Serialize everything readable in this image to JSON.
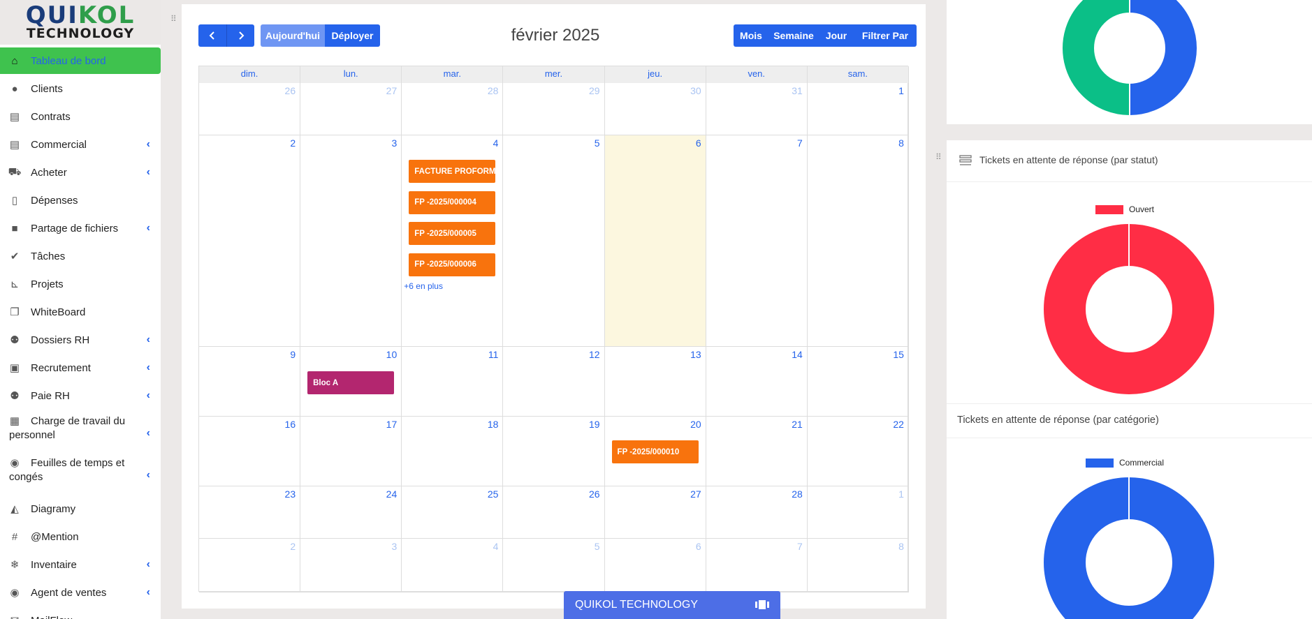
{
  "logo": {
    "line1_a": "QUI",
    "line1_b": "KOL",
    "line2": "TECHNOLOGY"
  },
  "sidebar": {
    "items": [
      {
        "label": "Tableau de bord",
        "icon": "home-icon",
        "active": true
      },
      {
        "label": "Clients",
        "icon": "user-icon"
      },
      {
        "label": "Contrats",
        "icon": "contract-icon"
      },
      {
        "label": "Commercial",
        "icon": "receipt-icon",
        "chevron": true
      },
      {
        "label": "Acheter",
        "icon": "cart-icon",
        "chevron": true
      },
      {
        "label": "Dépenses",
        "icon": "file-icon"
      },
      {
        "label": "Partage de fichiers",
        "icon": "folder-icon",
        "chevron": true
      },
      {
        "label": "Tâches",
        "icon": "check-circle-icon"
      },
      {
        "label": "Projets",
        "icon": "chart-icon"
      },
      {
        "label": "WhiteBoard",
        "icon": "copy-icon"
      },
      {
        "label": "Dossiers RH",
        "icon": "users-icon",
        "chevron": true
      },
      {
        "label": "Recrutement",
        "icon": "id-card-icon",
        "chevron": true
      },
      {
        "label": "Paie RH",
        "icon": "users-icon",
        "chevron": true
      },
      {
        "label": "Charge de travail du personnel",
        "icon": "calendar-icon",
        "chevron": true
      },
      {
        "label": "Feuilles de temps et congés",
        "icon": "user-circle-icon",
        "chevron": true
      },
      {
        "label": "Diagramy",
        "icon": "area-chart-icon"
      },
      {
        "label": "@Mention",
        "icon": "hash-icon"
      },
      {
        "label": "Inventaire",
        "icon": "snowflake-icon",
        "chevron": true
      },
      {
        "label": "Agent de ventes",
        "icon": "user-circle-icon",
        "chevron": true
      },
      {
        "label": "MailFlow",
        "icon": "mail-icon"
      }
    ]
  },
  "calendar": {
    "title": "février 2025",
    "today_label": "Aujourd'hui",
    "expand_label": "Déployer",
    "views": [
      "Mois",
      "Semaine",
      "Jour",
      "Filtrer Par"
    ],
    "weekdays": [
      "dim.",
      "lun.",
      "mar.",
      "mer.",
      "jeu.",
      "ven.",
      "sam."
    ],
    "weeks": [
      [
        "26",
        "27",
        "28",
        "29",
        "30",
        "31",
        "1"
      ],
      [
        "2",
        "3",
        "4",
        "5",
        "6",
        "7",
        "8"
      ],
      [
        "9",
        "10",
        "11",
        "12",
        "13",
        "14",
        "15"
      ],
      [
        "16",
        "17",
        "18",
        "19",
        "20",
        "21",
        "22"
      ],
      [
        "23",
        "24",
        "25",
        "26",
        "27",
        "28",
        "1"
      ],
      [
        "2",
        "3",
        "4",
        "5",
        "6",
        "7",
        "8"
      ]
    ],
    "events": {
      "feb4": [
        "FACTURE PROFORMA",
        "FP -2025/000004",
        "FP -2025/000005",
        "FP -2025/000006"
      ],
      "feb4_more": "+6 en plus",
      "feb10": "Bloc A",
      "feb20": "FP -2025/000010"
    }
  },
  "bottombar": {
    "label": "QUIKOL TECHNOLOGY"
  },
  "widgets": {
    "status_title": "Tickets en attente de réponse (par statut)",
    "status_legend": "Ouvert",
    "category_title": "Tickets en attente de réponse (par catégorie)",
    "category_legend": "Commercial"
  },
  "chart_data": [
    {
      "type": "pie",
      "slices": [
        {
          "value": 50,
          "color": "#2563eb"
        },
        {
          "value": 50,
          "color": "#0bbf87"
        }
      ]
    },
    {
      "type": "pie",
      "title": "Tickets en attente de réponse (par statut)",
      "slices": [
        {
          "label": "Ouvert",
          "value": 100,
          "color": "#ff2d45"
        }
      ]
    },
    {
      "type": "pie",
      "title": "Tickets en attente de réponse (par catégorie)",
      "slices": [
        {
          "label": "Commercial",
          "value": 100,
          "color": "#2563eb"
        }
      ]
    }
  ],
  "colors": {
    "accent": "#2563eb",
    "active": "#3fc24e",
    "event": "#f8730d",
    "event2": "#b3266f",
    "today": "#fcf7df"
  }
}
